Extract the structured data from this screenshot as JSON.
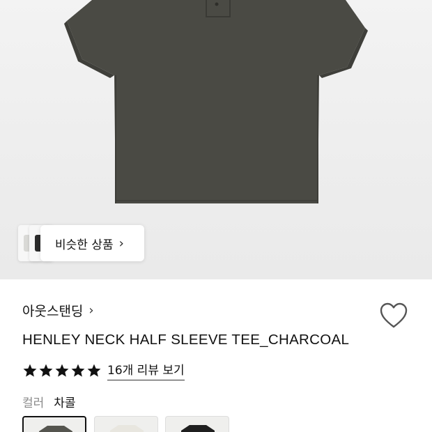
{
  "product": {
    "brand": "아웃스탠딩",
    "name": "HENLEY NECK HALF SLEEVE TEE_CHARCOAL",
    "rating_stars": 5,
    "reviews_link": "16개 리뷰 보기",
    "color_label": "컬러",
    "color_value": "차콜",
    "shirt_color": "#4a4a44"
  },
  "gallery": {
    "similar_button": "비슷한 상품",
    "thumbnails": [
      {
        "color": "#d9d9d6"
      },
      {
        "color": "#2b2b2b"
      }
    ]
  },
  "swatches": [
    {
      "name": "charcoal",
      "color": "#55554f",
      "selected": true
    },
    {
      "name": "ivory",
      "color": "#e8e6df",
      "selected": false
    },
    {
      "name": "black",
      "color": "#1f1f1f",
      "selected": false
    }
  ],
  "icons": {
    "heart": "heart-icon",
    "star": "star-icon",
    "chevron": "chevron-right-icon"
  }
}
